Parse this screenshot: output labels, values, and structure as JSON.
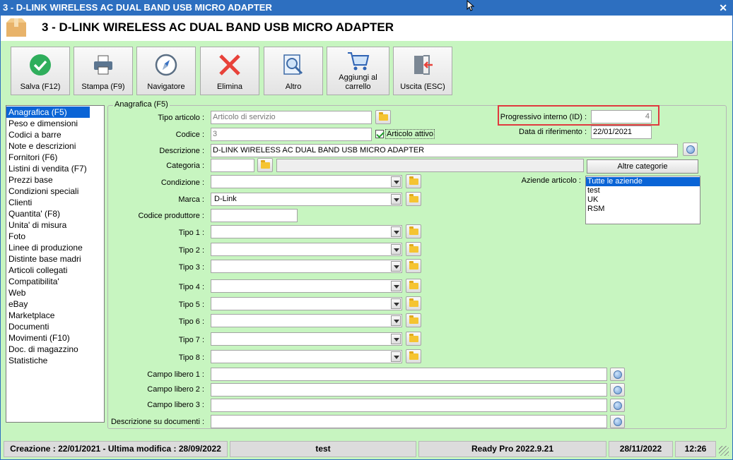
{
  "window": {
    "title": "3 - D-LINK WIRELESS AC DUAL BAND USB MICRO ADAPTER",
    "close_glyph": "✕"
  },
  "header": {
    "title": "3 - D-LINK WIRELESS AC DUAL BAND USB MICRO ADAPTER"
  },
  "toolbar": [
    {
      "label": "Salva (F12)",
      "icon": "check-circle-icon"
    },
    {
      "label": "Stampa (F9)",
      "icon": "printer-icon"
    },
    {
      "label": "Navigatore",
      "icon": "compass-icon"
    },
    {
      "label": "Elimina",
      "icon": "red-x-icon"
    },
    {
      "label": "Altro",
      "icon": "magnifier-icon"
    },
    {
      "label_line1": "Aggiungi al",
      "label_line2": "carrello",
      "icon": "shopping-cart-icon"
    },
    {
      "label": "Uscita (ESC)",
      "icon": "exit-door-icon"
    }
  ],
  "sidebar": {
    "items": [
      "Anagrafica (F5)",
      "Peso e dimensioni",
      "Codici a barre",
      "Note e descrizioni",
      "Fornitori (F6)",
      "Listini di vendita (F7)",
      "Prezzi base",
      "Condizioni speciali",
      "Clienti",
      "Quantita' (F8)",
      "Unita' di misura",
      "Foto",
      "Linee di produzione",
      "Distinte base madri",
      "Articoli collegati",
      "Compatibilita'",
      "Web",
      "eBay",
      "Marketplace",
      "Documenti",
      "Movimenti (F10)",
      "Doc. di magazzino",
      "Statistiche"
    ],
    "selected": "Anagrafica (F5)"
  },
  "form": {
    "group_title": "Anagrafica (F5)",
    "tipo_articolo": {
      "label": "Tipo articolo :",
      "value": "Articolo di servizio"
    },
    "codice": {
      "label": "Codice :",
      "value": "3"
    },
    "articolo_attivo": {
      "label": "Articolo attivo",
      "checked": true
    },
    "progressivo": {
      "label": "Progressivo interno (ID) :",
      "value": "4"
    },
    "data_riferimento": {
      "label": "Data di riferimento :",
      "value": "22/01/2021"
    },
    "descrizione": {
      "label": "Descrizione :",
      "value": "D-LINK WIRELESS AC DUAL BAND USB MICRO ADAPTER"
    },
    "categoria": {
      "label": "Categoria :",
      "value": ""
    },
    "altre_categorie": "Altre categorie",
    "condizione": {
      "label": "Condizione :",
      "value": ""
    },
    "aziende": {
      "label": "Aziende articolo :",
      "options": [
        "Tutte le aziende",
        "test",
        "UK",
        "RSM"
      ],
      "selected": "Tutte le aziende"
    },
    "marca": {
      "label": "Marca :",
      "value": "D-Link"
    },
    "codice_produttore": {
      "label": "Codice produttore :",
      "value": ""
    },
    "tipi": [
      {
        "label": "Tipo 1 :",
        "value": ""
      },
      {
        "label": "Tipo 2 :",
        "value": ""
      },
      {
        "label": "Tipo 3 :",
        "value": ""
      },
      {
        "label": "Tipo 4 :",
        "value": ""
      },
      {
        "label": "Tipo 5 :",
        "value": ""
      },
      {
        "label": "Tipo 6 :",
        "value": ""
      },
      {
        "label": "Tipo 7 :",
        "value": ""
      },
      {
        "label": "Tipo 8 :",
        "value": ""
      }
    ],
    "campi_liberi": [
      {
        "label": "Campo libero 1 :",
        "value": ""
      },
      {
        "label": "Campo libero 2 :",
        "value": ""
      },
      {
        "label": "Campo libero 3 :",
        "value": ""
      }
    ],
    "descrizione_documenti": {
      "label": "Descrizione su documenti :",
      "value": ""
    }
  },
  "statusbar": {
    "creation": "Creazione : 22/01/2021 - Ultima modifica : 28/09/2022",
    "user": "test",
    "version": "Ready Pro 2022.9.21",
    "date": "28/11/2022",
    "time": "12:26"
  },
  "colors": {
    "accent": "#2d6fc0",
    "background": "#c7f5c0",
    "selection": "#0a64d6",
    "highlight": "#e0393e"
  }
}
